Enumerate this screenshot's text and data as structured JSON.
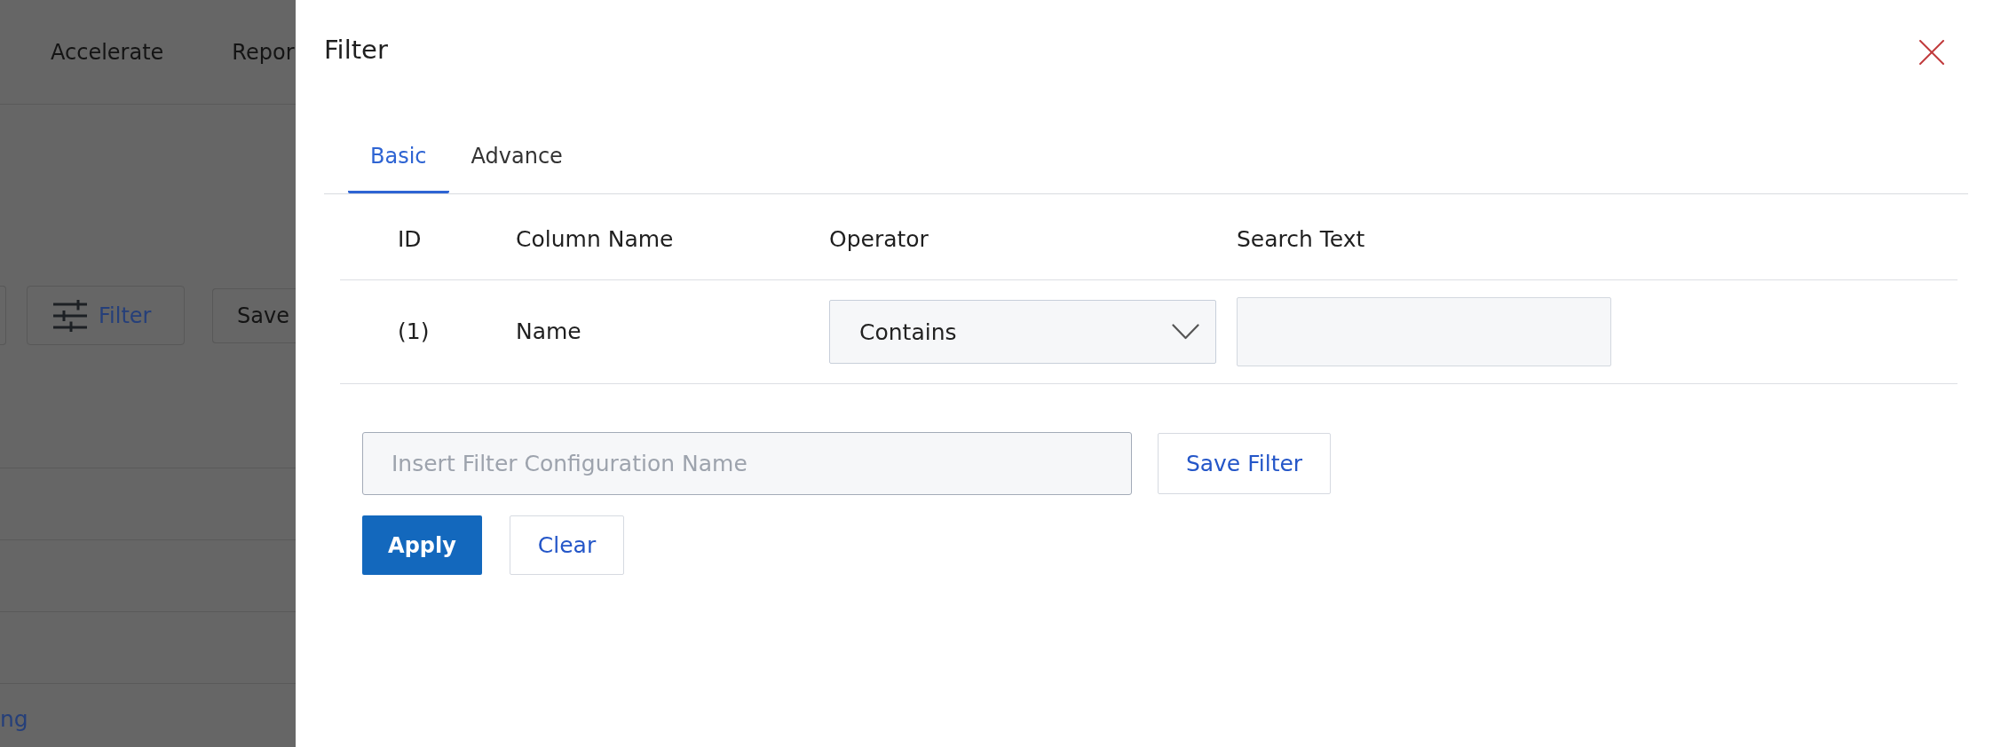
{
  "background_page": {
    "nav_items": [
      "Accelerate",
      "Repor"
    ],
    "toolbar": [
      {
        "kind": "clipped"
      },
      {
        "kind": "icon-button",
        "label": "Filter"
      },
      {
        "kind": "button",
        "label": "Save"
      }
    ],
    "link": "ng"
  },
  "filter_panel": {
    "title": "Filter",
    "tabs": [
      {
        "label": "Basic",
        "selected": true
      },
      {
        "label": "Advance",
        "selected": false
      }
    ],
    "table": {
      "columns": [
        "ID",
        "Column Name",
        "Operator",
        "Search Text"
      ],
      "rows": [
        {
          "id": "(1)",
          "column_name": "Name",
          "operator": "Contains"
        }
      ]
    },
    "config_name": {
      "placeholder": "Insert Filter Configuration Name"
    },
    "save_button": "Save Filter",
    "actions": [
      {
        "label": "Apply",
        "kind": "primary"
      },
      {
        "label": "Clear",
        "kind": "secondary"
      }
    ]
  }
}
